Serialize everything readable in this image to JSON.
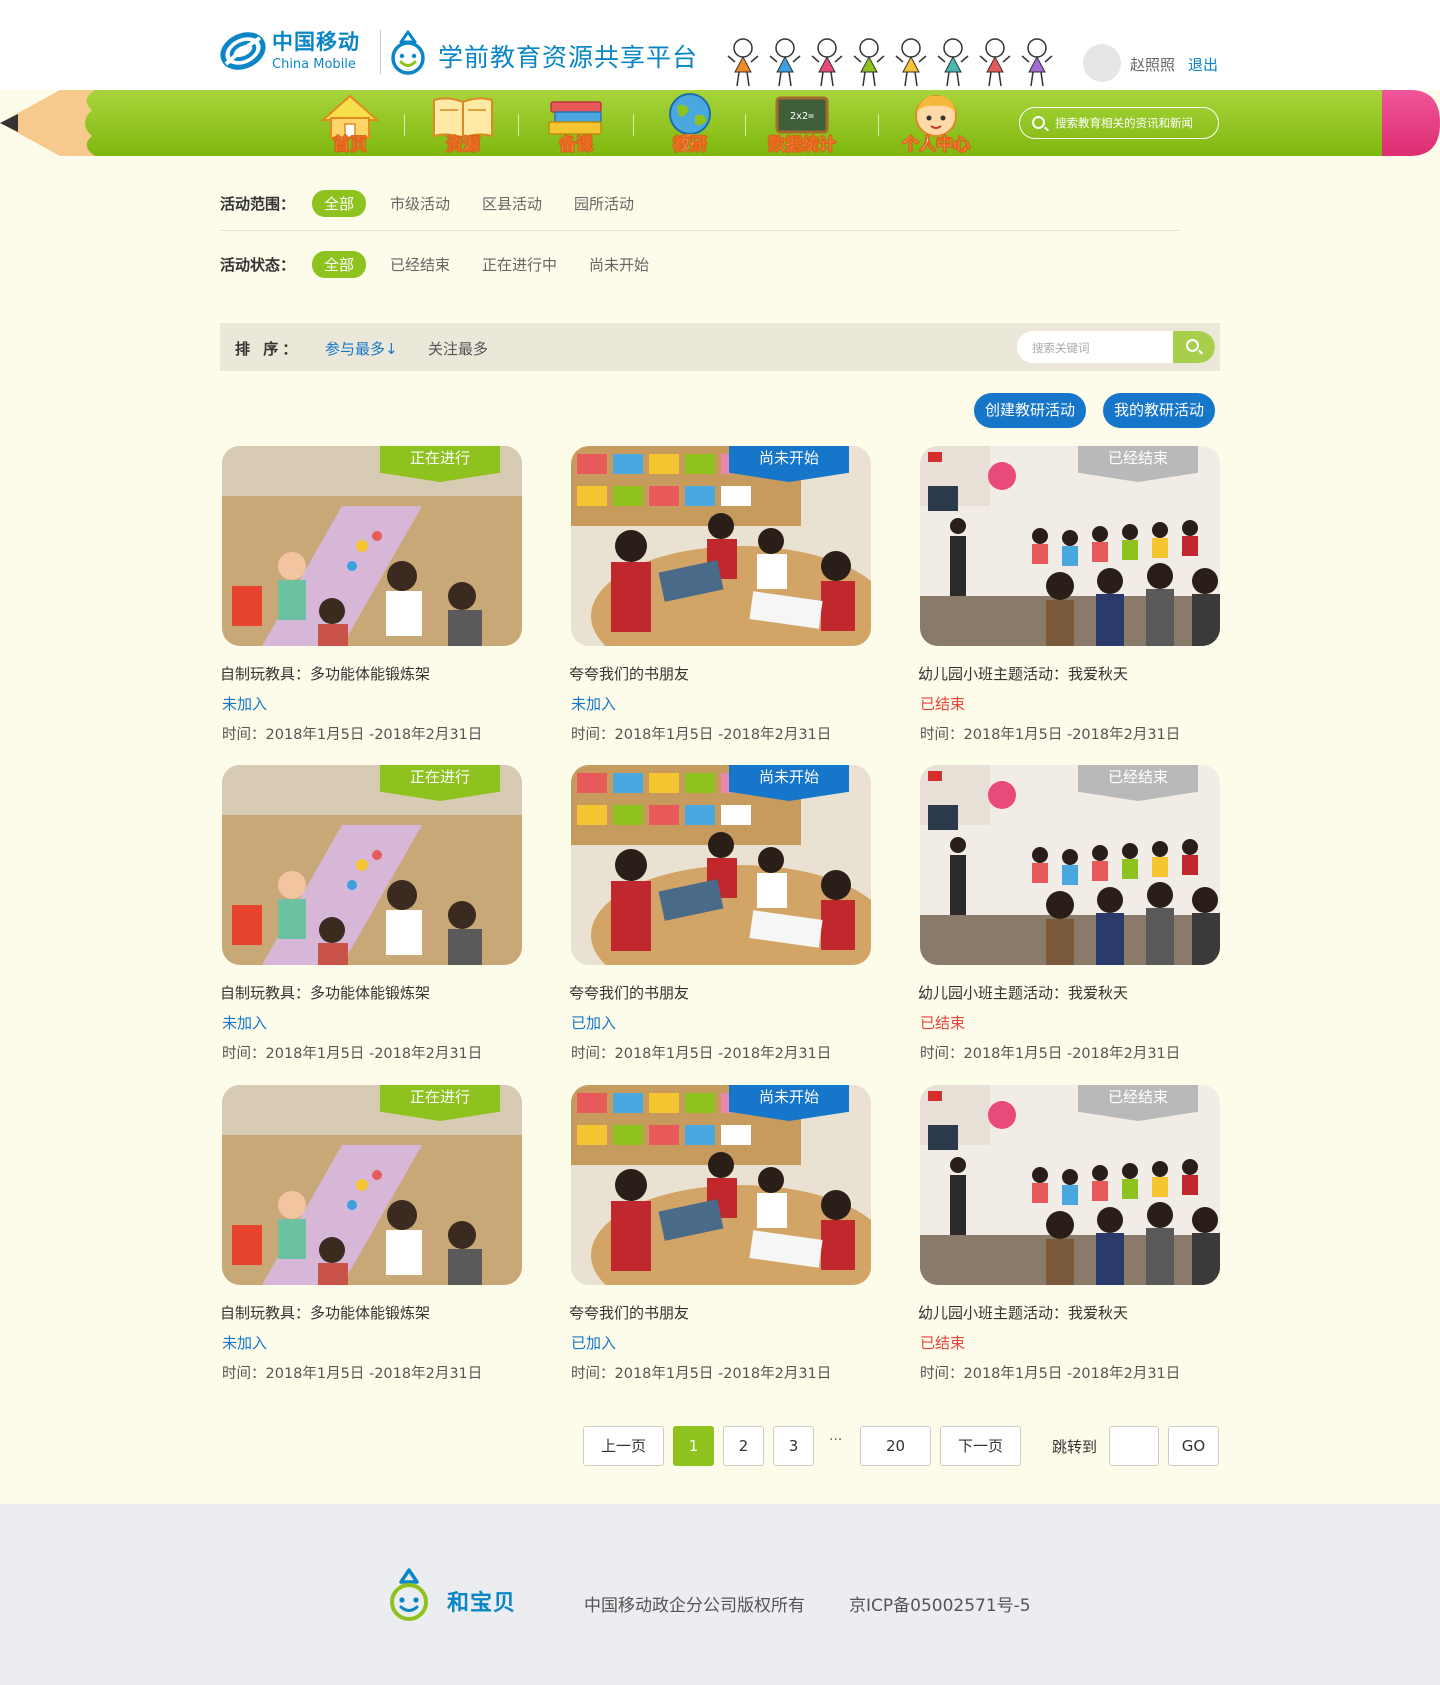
{
  "header": {
    "brand_cn": "中国移动",
    "brand_en": "China Mobile",
    "platform_title": "学前教育资源共享平台",
    "user_name": "赵照照",
    "logout": "退出"
  },
  "nav": {
    "items": [
      {
        "label": "首页",
        "icon": "house-icon"
      },
      {
        "label": "资源",
        "icon": "open-book-icon"
      },
      {
        "label": "备课",
        "icon": "book-stack-icon"
      },
      {
        "label": "教研",
        "icon": "globe-icon"
      },
      {
        "label": "数据统计",
        "icon": "chalkboard-icon"
      },
      {
        "label": "个人中心",
        "icon": "child-face-icon"
      }
    ],
    "search_placeholder": "搜索教育相关的资讯和新闻"
  },
  "filters": {
    "scope_label": "活动范围：",
    "scope_options": [
      "全部",
      "市级活动",
      "区县活动",
      "园所活动"
    ],
    "state_label": "活动状态：",
    "state_options": [
      "全部",
      "已经结束",
      "正在进行中",
      "尚未开始"
    ]
  },
  "sort": {
    "label": "排  序：",
    "options": [
      "参与最多↓",
      "关注最多"
    ],
    "search_placeholder": "搜索关键词"
  },
  "actions": {
    "create": "创建教研活动",
    "mine": "我的教研活动"
  },
  "cards": [
    {
      "ribbon": "正在进行",
      "title": "自制玩教具：多功能体能锻炼架",
      "status": "未加入",
      "time": "时间：2018年1月5日 -2018年2月31日"
    },
    {
      "ribbon": "尚未开始",
      "title": "夸夸我们的书朋友",
      "status": "未加入",
      "time": "时间：2018年1月5日 -2018年2月31日"
    },
    {
      "ribbon": "已经结束",
      "title": "幼儿园小班主题活动：我爱秋天",
      "status": "已结束",
      "time": "时间：2018年1月5日 -2018年2月31日"
    },
    {
      "ribbon": "正在进行",
      "title": "自制玩教具：多功能体能锻炼架",
      "status": "未加入",
      "time": "时间：2018年1月5日 -2018年2月31日"
    },
    {
      "ribbon": "尚未开始",
      "title": "夸夸我们的书朋友",
      "status": "已加入",
      "time": "时间：2018年1月5日 -2018年2月31日"
    },
    {
      "ribbon": "已经结束",
      "title": "幼儿园小班主题活动：我爱秋天",
      "status": "已结束",
      "time": "时间：2018年1月5日 -2018年2月31日"
    },
    {
      "ribbon": "正在进行",
      "title": "自制玩教具：多功能体能锻炼架",
      "status": "未加入",
      "time": "时间：2018年1月5日 -2018年2月31日"
    },
    {
      "ribbon": "尚未开始",
      "title": "夸夸我们的书朋友",
      "status": "已加入",
      "time": "时间：2018年1月5日 -2018年2月31日"
    },
    {
      "ribbon": "已经结束",
      "title": "幼儿园小班主题活动：我爱秋天",
      "status": "已结束",
      "time": "时间：2018年1月5日 -2018年2月31日"
    }
  ],
  "pagination": {
    "prev": "上一页",
    "pages": [
      "1",
      "2",
      "3"
    ],
    "ellipsis": "···",
    "last": "20",
    "next": "下一页",
    "jump_label": "跳转到",
    "go": "GO",
    "current": "1"
  },
  "footer": {
    "brand": "和宝贝",
    "copyright": "中国移动政企分公司版权所有",
    "icp": "京ICP备05002571号-5"
  },
  "colors": {
    "accent_green": "#8ec31f",
    "accent_blue": "#1676c9",
    "brand_blue": "#0a86c7",
    "ended_red": "#e8453c",
    "ended_gray": "#b9b9b9",
    "page_bg": "#fdfbe9"
  }
}
